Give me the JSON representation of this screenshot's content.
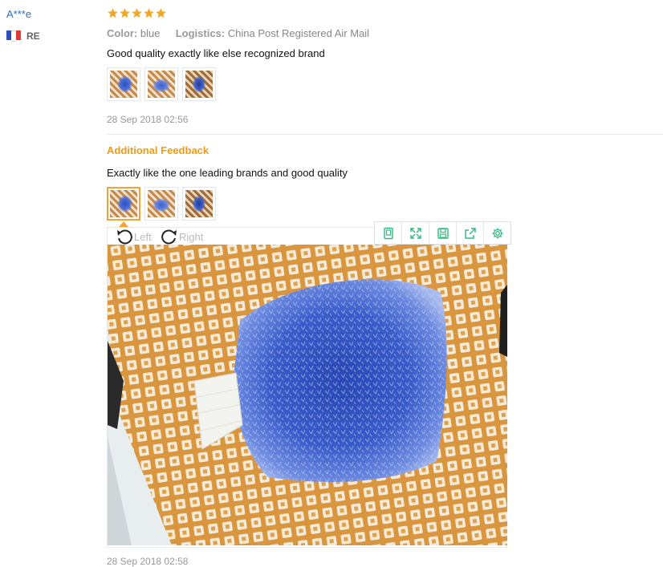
{
  "user": {
    "name": "A***e",
    "country": "RE",
    "flag_colors": [
      "#2b4fb8",
      "#ffffff",
      "#e53935"
    ]
  },
  "review": {
    "rating": 5,
    "star_color": "#f5a623",
    "color_label": "Color:",
    "color_value": "blue",
    "logistics_label": "Logistics:",
    "logistics_value": "China Post Registered Air Mail",
    "text": "Good quality exactly like else recognized brand",
    "date": "28 Sep 2018 02:56",
    "thumbnail_count": 3
  },
  "additional": {
    "title": "Additional Feedback",
    "text": "Exactly like the one leading brands and good quality",
    "thumbnail_count": 3,
    "selected_thumbnail": 1,
    "date": "28 Sep 2018 02:58"
  },
  "viewer": {
    "rotate_left_label": "Left",
    "rotate_right_label": "Right",
    "toolbar": [
      "copy-icon",
      "fullscreen-icon",
      "save-icon",
      "share-icon",
      "settings-icon"
    ],
    "accent": "#2dbb7f"
  }
}
